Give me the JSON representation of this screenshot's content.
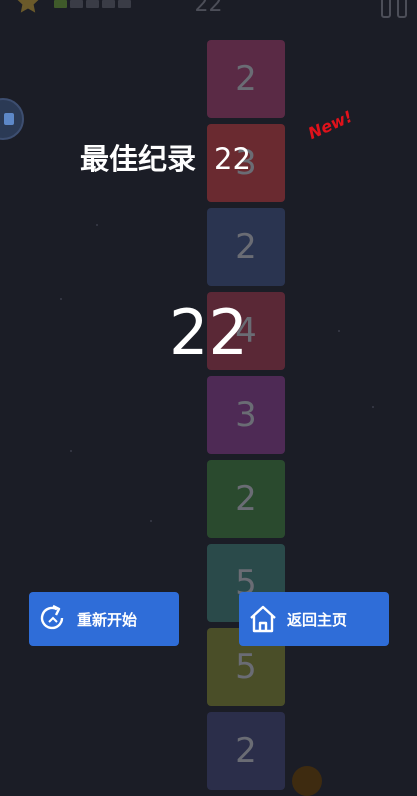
{
  "hud": {
    "score": "22",
    "progress_segments_total": 5,
    "progress_segments_filled": 1
  },
  "tiles": [
    {
      "value": "2",
      "color": "#5a2a45"
    },
    {
      "value": "3",
      "color": "#6a2a30"
    },
    {
      "value": "2",
      "color": "#2a3450"
    },
    {
      "value": "4",
      "color": "#5a2836"
    },
    {
      "value": "3",
      "color": "#4e2a55"
    },
    {
      "value": "2",
      "color": "#2a4a2e"
    },
    {
      "value": "5",
      "color": "#2a4a4a"
    },
    {
      "value": "5",
      "color": "#4a4e28"
    },
    {
      "value": "2",
      "color": "#2b2e4a"
    }
  ],
  "result": {
    "best_label": "最佳纪录",
    "best_value": "22",
    "new_badge": "New!",
    "score": "22"
  },
  "buttons": {
    "restart_label": "重新开始",
    "home_label": "返回主页"
  },
  "colors": {
    "background": "#1b1d26",
    "button": "#2f6dd8",
    "new_badge": "#e0121b"
  }
}
